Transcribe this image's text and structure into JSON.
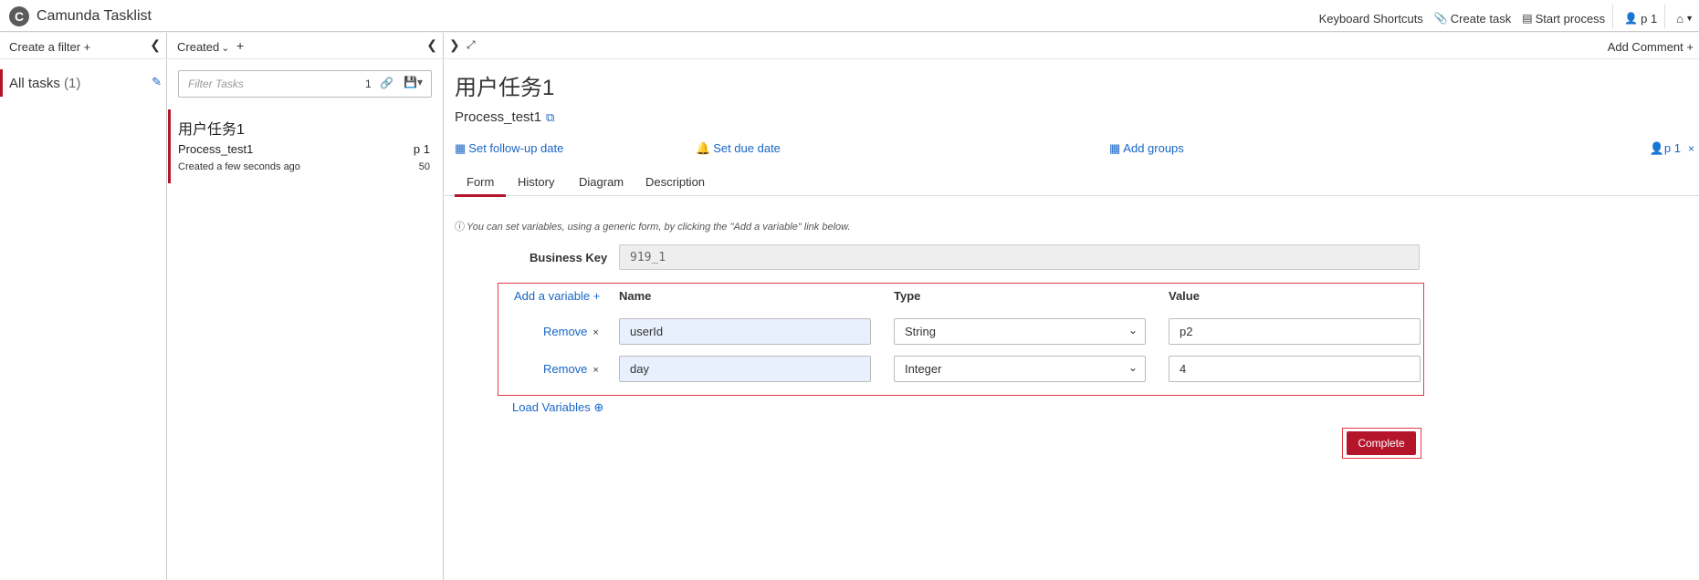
{
  "app": {
    "title": "Camunda Tasklist",
    "logo": "C"
  },
  "nav": {
    "keyboard_shortcuts": "Keyboard Shortcuts",
    "create_task": "Create task",
    "start_process": "Start process",
    "user": "p 1"
  },
  "filters": {
    "create_label": "Create a filter",
    "items": [
      {
        "label": "All tasks",
        "count": "(1)"
      }
    ]
  },
  "list": {
    "sort_label": "Created",
    "filter_placeholder": "Filter Tasks",
    "filter_count": "1",
    "tasks": [
      {
        "name": "用户任务1",
        "process": "Process_test1",
        "assignee": "p 1",
        "created": "Created a few seconds ago",
        "priority": "50"
      }
    ]
  },
  "detail": {
    "add_comment": "Add Comment",
    "title": "用户任务1",
    "process": "Process_test1",
    "follow_up": "Set follow-up date",
    "due_date": "Set due date",
    "add_groups": "Add groups",
    "assignee": "p 1",
    "tabs": [
      "Form",
      "History",
      "Diagram",
      "Description"
    ],
    "info": "You can set variables, using a generic form, by clicking the \"Add a variable\" link below.",
    "business_key_label": "Business Key",
    "business_key_value": "919_1",
    "add_variable": "Add a variable",
    "headers": {
      "name": "Name",
      "type": "Type",
      "value": "Value"
    },
    "remove_label": "Remove",
    "variables": [
      {
        "name": "userId",
        "type": "String",
        "value": "p2"
      },
      {
        "name": "day",
        "type": "Integer",
        "value": "4"
      }
    ],
    "load_variables": "Load Variables",
    "complete": "Complete"
  },
  "colors": {
    "accent": "#b5152b",
    "link": "#1866c7",
    "highlight": "#e33a47"
  }
}
